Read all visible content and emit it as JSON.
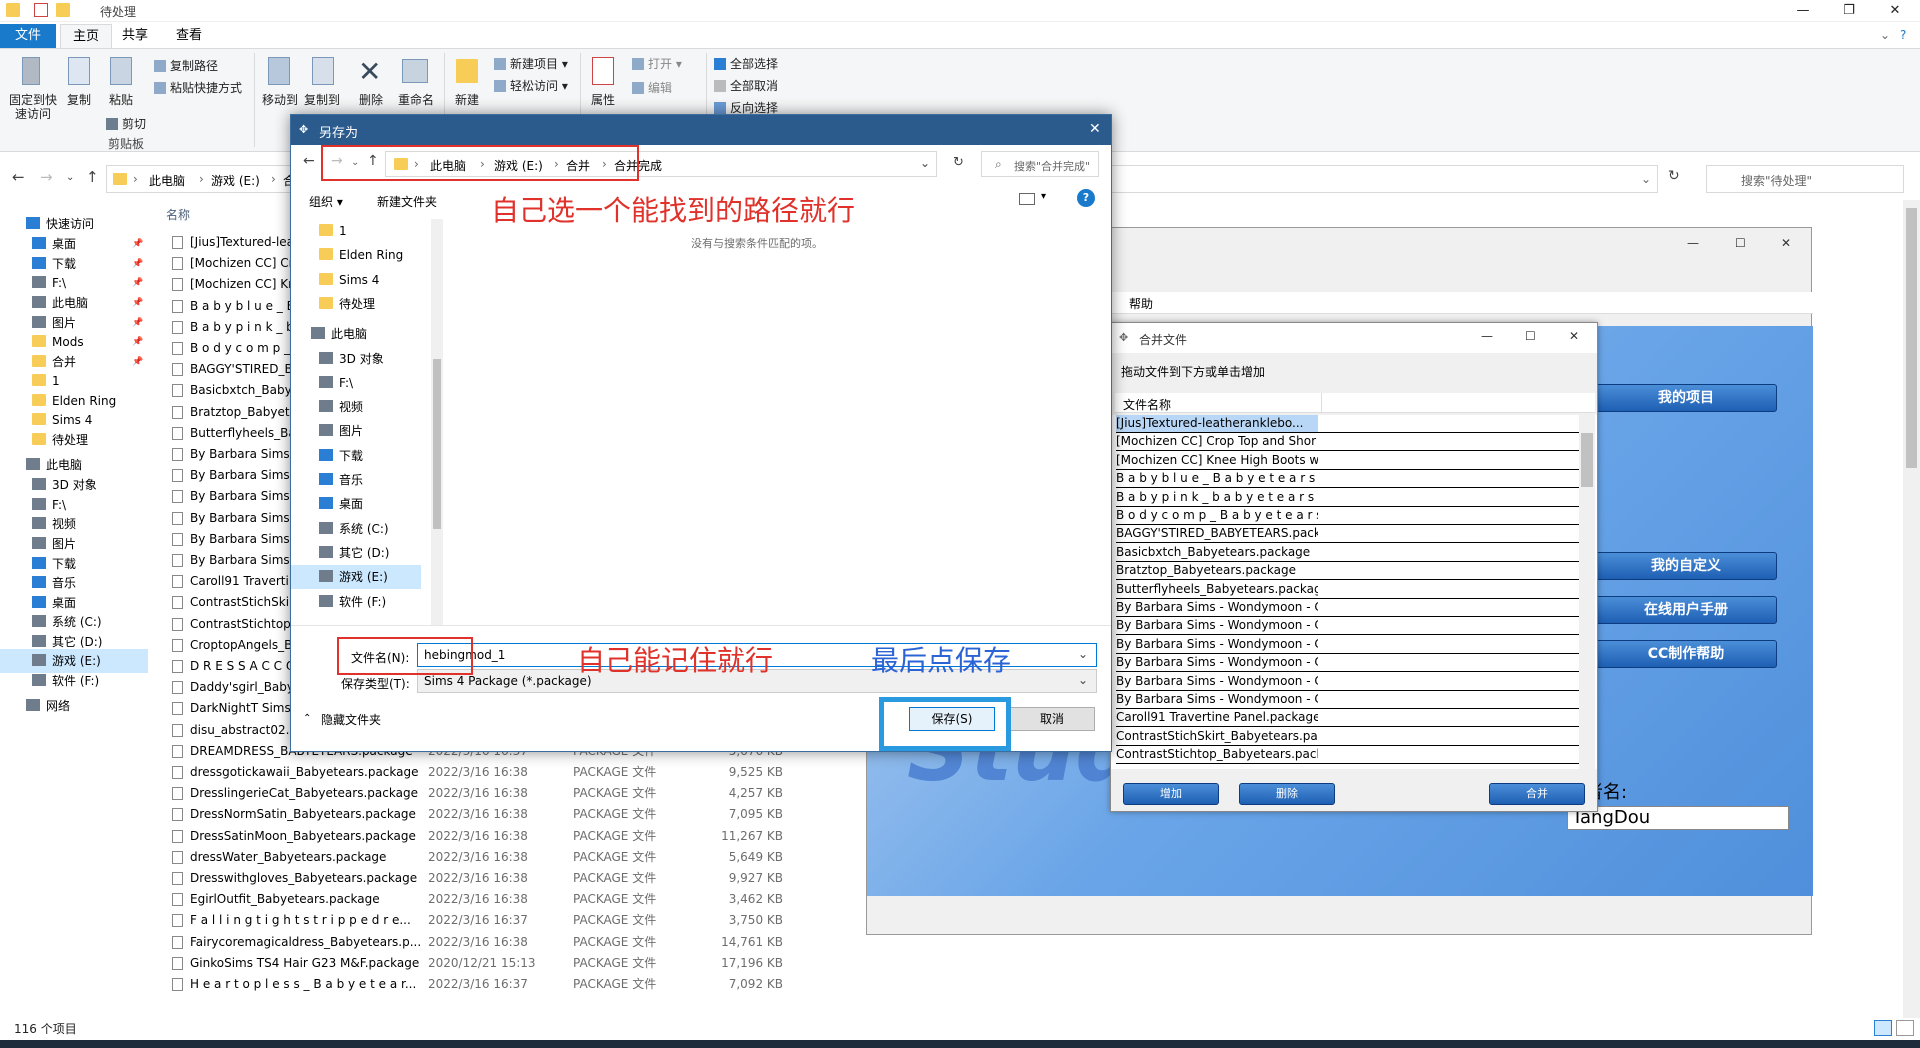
{
  "explorer": {
    "title": "待处理",
    "tabs": [
      "文件",
      "主页",
      "共享",
      "查看"
    ],
    "ribbon": {
      "pin_label": "固定到快\n速访问",
      "copy_label": "复制",
      "paste_label": "粘贴",
      "copy_path": "复制路径",
      "paste_shortcut": "粘贴快捷方式",
      "cut": "剪切",
      "clipboard_group": "剪贴板",
      "move_to": "移动到",
      "copy_to": "复制到",
      "delete": "删除",
      "rename": "重命名",
      "new_folder": "新建",
      "new_item": "新建项目",
      "easy_access": "轻松访问",
      "properties": "属性",
      "open": "打开",
      "edit": "编辑",
      "select_all": "全部选择",
      "select_none": "全部取消",
      "invert_selection": "反向选择"
    },
    "address": {
      "crumbs": [
        "此电脑",
        "游戏 (E:)",
        "合"
      ],
      "search_placeholder": "搜索\"待处理\""
    },
    "nav": [
      {
        "label": "快速访问",
        "icon": "star-icon",
        "pin": false
      },
      {
        "label": "桌面",
        "icon": "desktop-icon",
        "pin": true
      },
      {
        "label": "下载",
        "icon": "download-icon",
        "pin": true
      },
      {
        "label": "F:\\",
        "icon": "drive-icon",
        "pin": true
      },
      {
        "label": "此电脑",
        "icon": "computer-icon",
        "pin": true
      },
      {
        "label": "图片",
        "icon": "pictures-icon",
        "pin": true
      },
      {
        "label": "Mods",
        "icon": "folder-icon",
        "pin": true
      },
      {
        "label": "合并",
        "icon": "folder-icon",
        "pin": true
      },
      {
        "label": "1",
        "icon": "folder-icon",
        "pin": false
      },
      {
        "label": "Elden Ring",
        "icon": "folder-icon",
        "pin": false
      },
      {
        "label": "Sims 4",
        "icon": "folder-icon",
        "pin": false
      },
      {
        "label": "待处理",
        "icon": "folder-icon",
        "pin": false
      },
      {
        "label": "此电脑",
        "icon": "computer-icon",
        "pin": false
      },
      {
        "label": "3D 对象",
        "icon": "3d-objects-icon",
        "pin": false
      },
      {
        "label": "F:\\",
        "icon": "drive-icon",
        "pin": false
      },
      {
        "label": "视频",
        "icon": "video-icon",
        "pin": false
      },
      {
        "label": "图片",
        "icon": "pictures-icon",
        "pin": false
      },
      {
        "label": "下载",
        "icon": "download-icon",
        "pin": false
      },
      {
        "label": "音乐",
        "icon": "music-icon",
        "pin": false
      },
      {
        "label": "桌面",
        "icon": "desktop-icon",
        "pin": false
      },
      {
        "label": "系统 (C:)",
        "icon": "drive-icon",
        "pin": false
      },
      {
        "label": "其它 (D:)",
        "icon": "drive-icon",
        "pin": false
      },
      {
        "label": "游戏 (E:)",
        "icon": "drive-icon",
        "pin": false
      },
      {
        "label": "软件 (F:)",
        "icon": "drive-icon",
        "pin": false
      },
      {
        "label": "网络",
        "icon": "network-icon",
        "pin": false
      }
    ],
    "column_name": "名称",
    "files": [
      {
        "name": "[Jius]Textured-lea",
        "date": "",
        "type": "",
        "size": ""
      },
      {
        "name": "[Mochizen CC] Cr",
        "date": "",
        "type": "",
        "size": ""
      },
      {
        "name": "[Mochizen CC] Kr",
        "date": "",
        "type": "",
        "size": ""
      },
      {
        "name": "B a b y b l u e _ B",
        "date": "",
        "type": "",
        "size": ""
      },
      {
        "name": "B a b y p i n k _ b",
        "date": "",
        "type": "",
        "size": ""
      },
      {
        "name": "B o d y c o m p _",
        "date": "",
        "type": "",
        "size": ""
      },
      {
        "name": "BAGGY'STIRED_BABY",
        "date": "",
        "type": "",
        "size": ""
      },
      {
        "name": "Basicbxtch_Babye",
        "date": "",
        "type": "",
        "size": ""
      },
      {
        "name": "Bratztop_Babyete",
        "date": "",
        "type": "",
        "size": ""
      },
      {
        "name": "Butterflyheels_Bal",
        "date": "",
        "type": "",
        "size": ""
      },
      {
        "name": "By Barbara Sims",
        "date": "",
        "type": "",
        "size": ""
      },
      {
        "name": "By Barbara Sims",
        "date": "",
        "type": "",
        "size": ""
      },
      {
        "name": "By Barbara Sims",
        "date": "",
        "type": "",
        "size": ""
      },
      {
        "name": "By Barbara Sims",
        "date": "",
        "type": "",
        "size": ""
      },
      {
        "name": "By Barbara Sims",
        "date": "",
        "type": "",
        "size": ""
      },
      {
        "name": "By Barbara Sims",
        "date": "",
        "type": "",
        "size": ""
      },
      {
        "name": "Caroll91 Traverti",
        "date": "",
        "type": "",
        "size": ""
      },
      {
        "name": "ContrastStichSkirt",
        "date": "",
        "type": "",
        "size": ""
      },
      {
        "name": "ContrastStichtop_",
        "date": "",
        "type": "",
        "size": ""
      },
      {
        "name": "CroptopAngels_B",
        "date": "",
        "type": "",
        "size": ""
      },
      {
        "name": "D R E S S A C C O",
        "date": "",
        "type": "",
        "size": ""
      },
      {
        "name": "Daddy'sgirl_Baby",
        "date": "",
        "type": "",
        "size": ""
      },
      {
        "name": "DarkNightT Sims-",
        "date": "",
        "type": "",
        "size": ""
      },
      {
        "name": "disu_abstract02.p",
        "date": "",
        "type": "",
        "size": ""
      },
      {
        "name": "DREAMDRESS_BABYETEARS.package",
        "date": "2022/3/16 16:37",
        "type": "PACKAGE 文件",
        "size": "5,676 KB"
      },
      {
        "name": "dressgotickawaii_Babyetears.package",
        "date": "2022/3/16 16:38",
        "type": "PACKAGE 文件",
        "size": "9,525 KB"
      },
      {
        "name": "DresslingerieCat_Babyetears.package",
        "date": "2022/3/16 16:38",
        "type": "PACKAGE 文件",
        "size": "4,257 KB"
      },
      {
        "name": "DressNormSatin_Babyetears.package",
        "date": "2022/3/16 16:38",
        "type": "PACKAGE 文件",
        "size": "7,095 KB"
      },
      {
        "name": "DressSatinMoon_Babyetears.package",
        "date": "2022/3/16 16:38",
        "type": "PACKAGE 文件",
        "size": "11,267 KB"
      },
      {
        "name": "dressWater_Babyetears.package",
        "date": "2022/3/16 16:38",
        "type": "PACKAGE 文件",
        "size": "5,649 KB"
      },
      {
        "name": "Dresswithgloves_Babyetears.package",
        "date": "2022/3/16 16:38",
        "type": "PACKAGE 文件",
        "size": "9,927 KB"
      },
      {
        "name": "EgirlOutfit_Babyetears.package",
        "date": "2022/3/16 16:38",
        "type": "PACKAGE 文件",
        "size": "3,462 KB"
      },
      {
        "name": "F a l l i n g t i g h t s t r i p p e d r e...",
        "date": "2022/3/16 16:37",
        "type": "PACKAGE 文件",
        "size": "3,750 KB"
      },
      {
        "name": "Fairycoremagicaldress_Babyetears.p...",
        "date": "2022/3/16 16:38",
        "type": "PACKAGE 文件",
        "size": "14,761 KB"
      },
      {
        "name": "GinkoSims TS4 Hair G23 M&F.package",
        "date": "2020/12/21 15:13",
        "type": "PACKAGE 文件",
        "size": "17,196 KB"
      },
      {
        "name": "H e a r t o p l e s s _ B a b y e t e a r...",
        "date": "2022/3/16 16:37",
        "type": "PACKAGE 文件",
        "size": "7,092 KB"
      }
    ],
    "status": "116 个项目"
  },
  "app": {
    "menu_help": "帮助",
    "buttons": [
      "我的项目",
      "我的自定义",
      "在线用户手册",
      "CC制作帮助"
    ],
    "studio_text": "Studio",
    "author_label": "作者名:",
    "author_value": "TangDou"
  },
  "merge": {
    "title": "合并文件",
    "hint": "拖动文件到下方或单击增加",
    "column": "文件名称",
    "rows": [
      "[Jius]Textured-leatheranklebo...",
      "[Mochizen CC] Crop Top and Shor",
      "[Mochizen CC] Knee High Boots w",
      "B a b y b l u e _ B a b y e t e a r s . p",
      "B a b y p i n k _ b a b y e t e a r s . p",
      "B o d y c o m p _ B a b y e t e a r s .",
      "BAGGY'STIRED_BABYETEARS.package",
      "Basicbxtch_Babyetears.package",
      "Bratztop_Babyetears.package",
      "Butterflyheels_Babyetears.package",
      "By Barbara Sims - Wondymoon - C",
      "By Barbara Sims - Wondymoon - C",
      "By Barbara Sims - Wondymoon - C",
      "By Barbara Sims - Wondymoon - C",
      "By Barbara Sims - Wondymoon - C",
      "By Barbara Sims - Wondymoon - C",
      "Caroll91 Travertine Panel.package",
      "ContrastStichSkirt_Babyetears.pack",
      "ContrastStichtop_Babyetears.pack"
    ],
    "add": "增加",
    "remove": "删除",
    "merge": "合并"
  },
  "save": {
    "title": "另存为",
    "crumbs": [
      "此电脑",
      "游戏 (E:)",
      "合并",
      "合并完成"
    ],
    "search_placeholder": "搜索\"合并完成\"",
    "organize": "组织 ▾",
    "new_folder": "新建文件夹",
    "empty_text": "没有与搜索条件匹配的项。",
    "nav": [
      {
        "label": "1",
        "icon": "folder-icon"
      },
      {
        "label": "Elden Ring",
        "icon": "folder-icon"
      },
      {
        "label": "Sims 4",
        "icon": "folder-icon"
      },
      {
        "label": "待处理",
        "icon": "folder-icon"
      },
      {
        "label": "此电脑",
        "icon": "computer-icon"
      },
      {
        "label": "3D 对象",
        "icon": "3d-objects-icon"
      },
      {
        "label": "F:\\",
        "icon": "drive-icon"
      },
      {
        "label": "视频",
        "icon": "video-icon"
      },
      {
        "label": "图片",
        "icon": "pictures-icon"
      },
      {
        "label": "下载",
        "icon": "download-icon"
      },
      {
        "label": "音乐",
        "icon": "music-icon"
      },
      {
        "label": "桌面",
        "icon": "desktop-icon"
      },
      {
        "label": "系统 (C:)",
        "icon": "drive-icon"
      },
      {
        "label": "其它 (D:)",
        "icon": "drive-icon"
      },
      {
        "label": "游戏 (E:)",
        "icon": "drive-icon"
      },
      {
        "label": "软件 (F:)",
        "icon": "drive-icon"
      },
      {
        "label": "网络",
        "icon": "network-icon"
      }
    ],
    "filename_label": "文件名(N):",
    "filename_value": "hebingmod_1",
    "filetype_label": "保存类型(T):",
    "filetype_value": "Sims 4 Package (*.package)",
    "hide_folders": "隐藏文件夹",
    "save_button": "保存(S)",
    "cancel_button": "取消"
  },
  "annotations": {
    "path_hint": "自己选一个能找到的路径就行",
    "name_hint": "自己能记住就行",
    "save_hint": "最后点保存"
  },
  "colors": {
    "accent": "#1979ca",
    "annotation_red": "#e0322b",
    "annotation_blue": "#2b64d4",
    "dialog_title": "#2b5b8c"
  }
}
